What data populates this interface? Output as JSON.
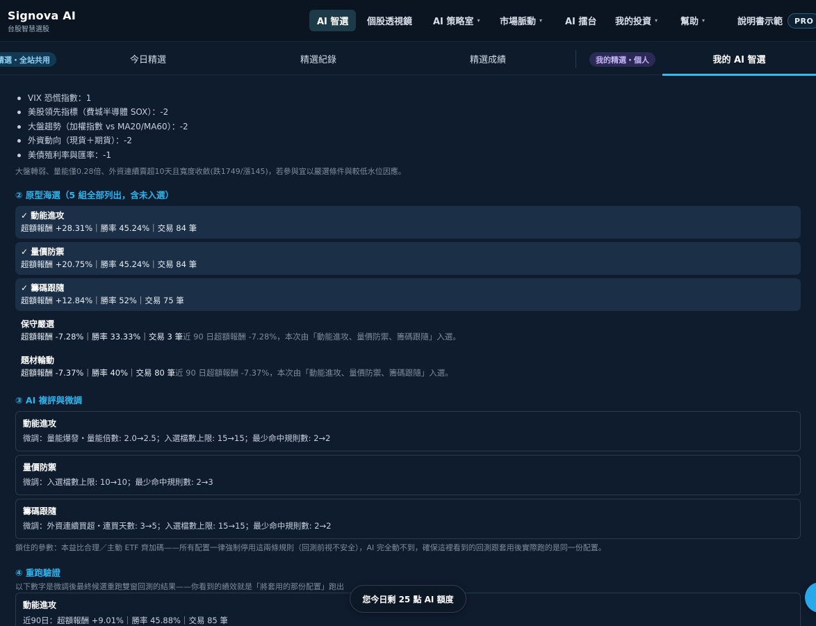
{
  "brand": {
    "name": "Signova AI",
    "subtitle": "台股智慧選股"
  },
  "nav": {
    "items": [
      {
        "label": "AI 智選",
        "active": true
      },
      {
        "label": "個股透視鏡"
      },
      {
        "label": "AI 策略室",
        "has_dropdown": true
      },
      {
        "label": "市場脈動",
        "has_dropdown": true
      },
      {
        "label": "AI 擂台"
      },
      {
        "label": "我的投資",
        "has_dropdown": true
      },
      {
        "label": "幫助",
        "has_dropdown": true
      },
      {
        "label": "說明書示範"
      }
    ],
    "pro_badge": "PRO",
    "caret_glyph": "▾"
  },
  "subtabs": {
    "shared_pill": "精選・全站共用",
    "personal_pill": "我的精選・個人",
    "tabs": [
      {
        "label": "今日精選"
      },
      {
        "label": "精選紀錄"
      },
      {
        "label": "精選成績"
      },
      {
        "label": "我的 AI 智選",
        "active": true
      }
    ]
  },
  "market_signals": {
    "items": [
      "VIX 恐慌指數：1",
      "美股領先指標（費城半導體 SOX）：-2",
      "大盤趨勢（加權指數 vs MA20/MA60）：-2",
      "外資動向（現貨＋期貨）：-2",
      "美債殖利率與匯率：-1"
    ],
    "note": "大盤轉弱、量能僅0.28倍、外資連續賣超10天且寬度收斂(跌1749/漲145)，若參與宜以嚴選條件與較低水位因應。"
  },
  "prototype_section": {
    "title": "② 原型海選（5 組全部列出，含未入選）",
    "items": [
      {
        "name": "✓ 動能進攻",
        "stats": "超額報酬 +28.31%｜勝率 45.24%｜交易 84 筆",
        "note": "",
        "selected": true
      },
      {
        "name": "✓ 量價防禦",
        "stats": "超額報酬 +20.75%｜勝率 45.24%｜交易 84 筆",
        "note": "",
        "selected": true
      },
      {
        "name": "✓ 籌碼跟隨",
        "stats": "超額報酬 +12.84%｜勝率 52%｜交易 75 筆",
        "note": "",
        "selected": true
      },
      {
        "name": "保守嚴選",
        "stats": "超額報酬 -7.28%｜勝率 33.33%｜交易 3 筆",
        "note": "近 90 日超額報酬 -7.28%，本次由「動能進攻、量價防禦、籌碼跟隨」入選。",
        "selected": false
      },
      {
        "name": "題材輪動",
        "stats": "超額報酬 -7.37%｜勝率 40%｜交易 80 筆",
        "note": "近 90 日超額報酬 -7.37%，本次由「動能進攻、量價防禦、籌碼跟隨」入選。",
        "selected": false
      }
    ]
  },
  "tuning_section": {
    "title": "③ AI 複評與微調",
    "cards": [
      {
        "name": "動能進攻",
        "detail": "微調：量能爆發・量能倍數: 2.0→2.5；入選檔數上限: 15→15；最少命中規則數: 2→2"
      },
      {
        "name": "量價防禦",
        "detail": "微調：入選檔數上限: 10→10；最少命中規則數: 2→3"
      },
      {
        "name": "籌碼跟隨",
        "detail": "微調：外資連續買超・連買天數: 3→5；入選檔數上限: 15→15；最少命中規則數: 2→2"
      }
    ],
    "note": "鎖住的參數：本益比合理／主動 ETF 齊加碼——所有配置一律強制停用這兩條規則（回測前視不安全），AI 完全動不到，確保這裡看到的回測跟套用後實際跑的是同一份配置。"
  },
  "rerun_section": {
    "title": "④ 重跑驗證",
    "intro": "以下數字是微調後最終候選重跑雙窗回測的結果——你看到的績效就是「將套用的那份配置」跑出",
    "cards": [
      {
        "name": "動能進攻",
        "detail": "近90日：超額報酬 +9.01%｜勝率 45.88%｜交易 85 筆"
      }
    ]
  },
  "quota_toast": "您今日剩 25 點 AI 額度",
  "colors": {
    "accent": "#2cb3ec",
    "background": "#0f1c2e",
    "selected_row": "#1b2f47"
  }
}
